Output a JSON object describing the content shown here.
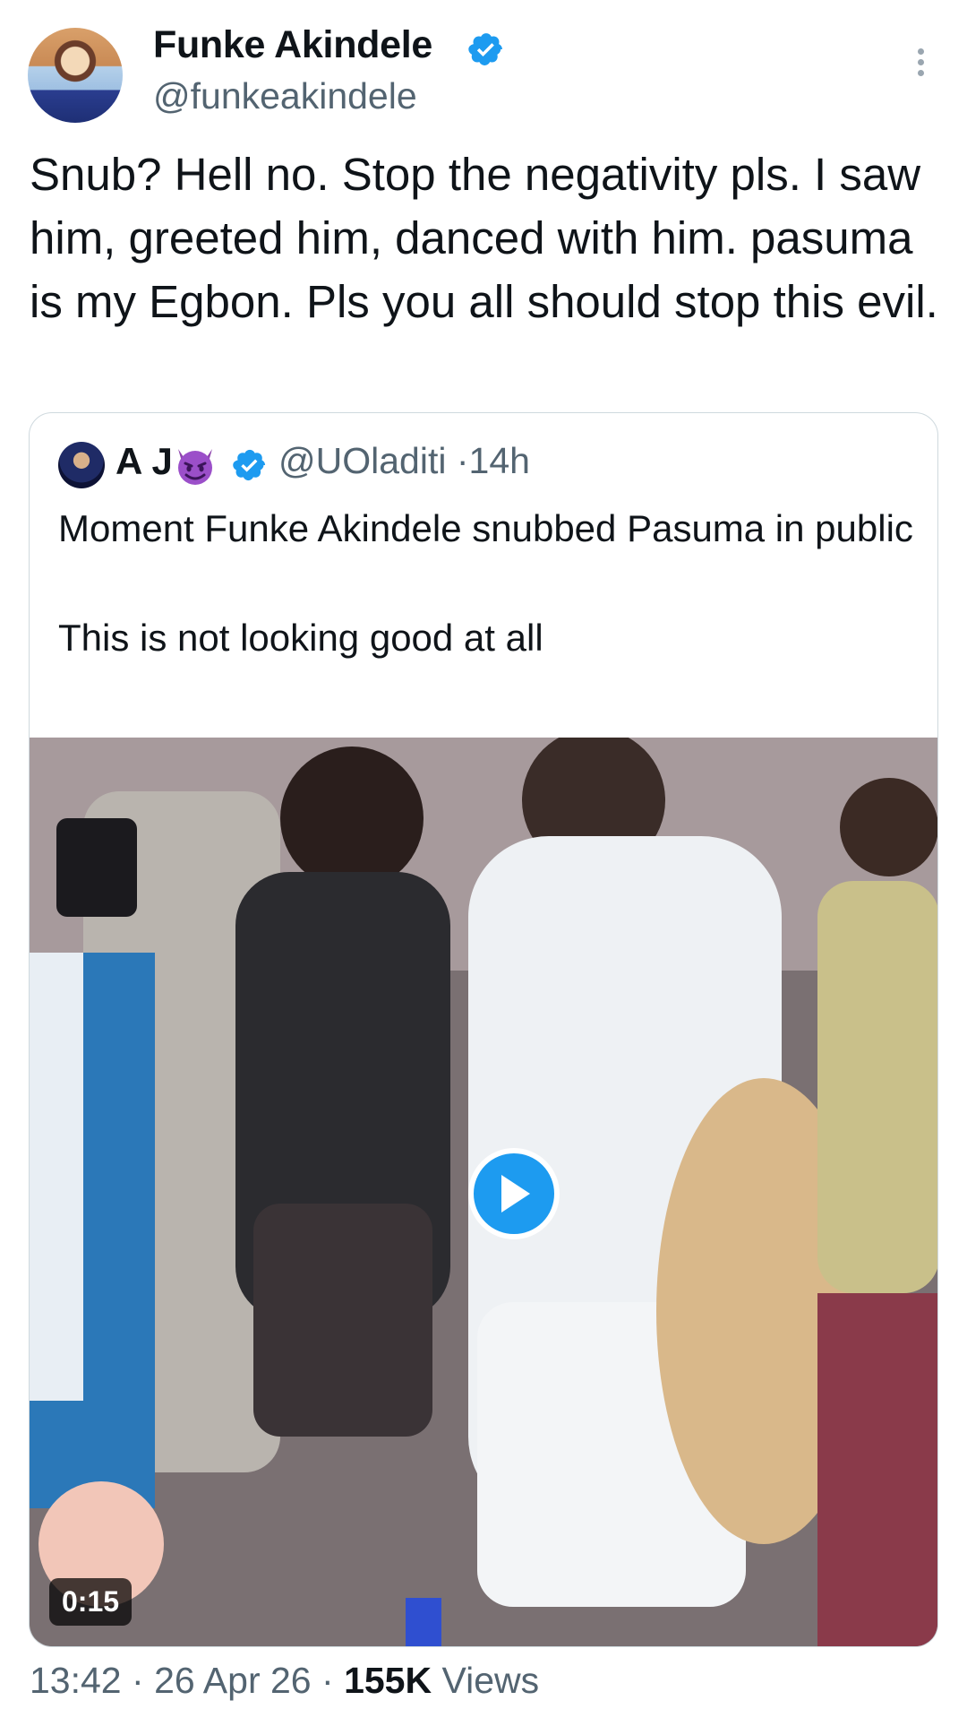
{
  "author": {
    "name": "Funke Akindele",
    "handle": "@funkeakindele",
    "verified": true
  },
  "tweet": {
    "text": "Snub? Hell no. Stop the negativity pls. I saw him, greeted him, danced with him. pasuma is my Egbon. Pls you all should stop this evil."
  },
  "quoted_tweet": {
    "name": "A J",
    "emoji_icon": "smiling-face-with-horns-icon",
    "handle": "@UOladiti",
    "separator": "·",
    "age": "14h",
    "text": "Moment Funke Akindele snubbed Pasuma in public\n\nThis is not looking good at all",
    "video": {
      "duration": "0:15"
    }
  },
  "meta": {
    "time": "13:42",
    "date": "26 Apr 26",
    "views_count": "155K",
    "views_label": "Views",
    "separator": "·"
  },
  "colors": {
    "accent": "#1d9bf0",
    "secondary_text": "#536471",
    "primary_text": "#0f1419",
    "border": "#cfd9de"
  }
}
